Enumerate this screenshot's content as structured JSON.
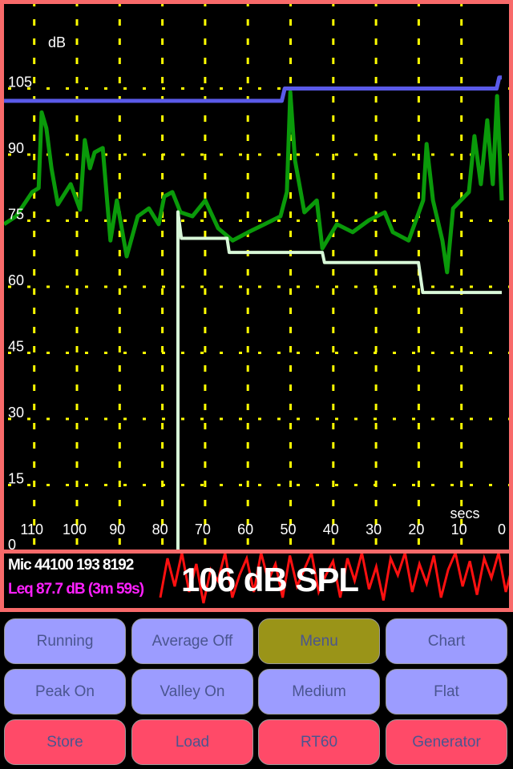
{
  "colors": {
    "frame": "#f86a6a",
    "level_line": "#0a9a0a",
    "peak_line": "#5a5ae8",
    "valley_line": "#d8f8d8",
    "grid": "#ffff00",
    "waveform": "#ff1010",
    "button_blue": "#9c9cff",
    "button_olive": "#9a9418",
    "button_red": "#ff4a68"
  },
  "chart_data": {
    "type": "line",
    "ylabel": "dB",
    "xlabel": "secs",
    "xlim": [
      117,
      0
    ],
    "ylim": [
      0,
      110
    ],
    "y_ticks": [
      "105",
      "90",
      "75",
      "60",
      "45",
      "30",
      "15",
      "0"
    ],
    "y_tick_values": [
      105,
      90,
      75,
      60,
      45,
      30,
      15,
      0
    ],
    "x_ticks": [
      "110",
      "100",
      "90",
      "80",
      "70",
      "60",
      "50",
      "40",
      "30",
      "20",
      "10",
      "0"
    ],
    "x_tick_values": [
      110,
      100,
      90,
      80,
      70,
      60,
      50,
      40,
      30,
      20,
      10,
      0
    ],
    "grid": true,
    "series": [
      {
        "key": "level",
        "points": [
          [
            116.5,
            74.2
          ],
          [
            113.7,
            76
          ],
          [
            109.9,
            81.5
          ],
          [
            108.4,
            82.4
          ],
          [
            107.7,
            99.6
          ],
          [
            106.6,
            96
          ],
          [
            105.4,
            86.9
          ],
          [
            103.9,
            78.7
          ],
          [
            100.9,
            83.3
          ],
          [
            98.7,
            77.5
          ],
          [
            97.6,
            93.3
          ],
          [
            96.4,
            86.9
          ],
          [
            95.3,
            90.5
          ],
          [
            93.4,
            91.5
          ],
          [
            91.6,
            70.5
          ],
          [
            90.1,
            79.6
          ],
          [
            87.8,
            66.9
          ],
          [
            85.2,
            76
          ],
          [
            82.6,
            77.8
          ],
          [
            80.3,
            74.2
          ],
          [
            79,
            80.5
          ],
          [
            77.1,
            81.5
          ],
          [
            75.2,
            76.9
          ],
          [
            72.4,
            76
          ],
          [
            69.4,
            79.6
          ],
          [
            66.4,
            73.3
          ],
          [
            63,
            70.5
          ],
          [
            59.3,
            72.4
          ],
          [
            55.5,
            74.2
          ],
          [
            51.8,
            76
          ],
          [
            50.3,
            81.5
          ],
          [
            49.5,
            104.2
          ],
          [
            48.4,
            88.7
          ],
          [
            46.2,
            76.9
          ],
          [
            43.3,
            79.6
          ],
          [
            42,
            68.7
          ],
          [
            38.6,
            74.2
          ],
          [
            34.9,
            72.4
          ],
          [
            31.1,
            75.1
          ],
          [
            27.4,
            76.9
          ],
          [
            25.5,
            72.4
          ],
          [
            21.8,
            70.5
          ],
          [
            18.4,
            79.6
          ],
          [
            17.6,
            92.4
          ],
          [
            16.1,
            79.6
          ],
          [
            13.9,
            70.5
          ],
          [
            12.8,
            63.3
          ],
          [
            11.4,
            77.8
          ],
          [
            7.7,
            81.5
          ],
          [
            6.4,
            94.2
          ],
          [
            4.9,
            83.3
          ],
          [
            3.4,
            97.8
          ],
          [
            2.1,
            83.3
          ],
          [
            1.1,
            103.3
          ],
          [
            0,
            79.6
          ]
        ]
      },
      {
        "key": "peak",
        "points": [
          [
            116.5,
            102.2
          ],
          [
            51.5,
            102.2
          ],
          [
            50.8,
            105
          ],
          [
            1.2,
            105
          ],
          [
            0.6,
            107.5
          ],
          [
            0,
            107.5
          ]
        ]
      },
      {
        "key": "valley",
        "points": [
          [
            75.8,
            0
          ],
          [
            75.8,
            77
          ],
          [
            75,
            71
          ],
          [
            64.3,
            71
          ],
          [
            63.8,
            67.8
          ],
          [
            42,
            67.8
          ],
          [
            41.5,
            65.5
          ],
          [
            19.5,
            65.5
          ],
          [
            18.5,
            58.7
          ],
          [
            0,
            58.7
          ]
        ]
      }
    ],
    "waveform": [
      0.2,
      0.9,
      0.4,
      1,
      0.3,
      0.8,
      0.1,
      0.7,
      0.5,
      1,
      0.2,
      0.6,
      0.9,
      0.3,
      1,
      0.5,
      0.8,
      0.2,
      0.95,
      0.4,
      0.7,
      1,
      0.3,
      0.6,
      0.85,
      0.2,
      0.9,
      0.5,
      1,
      0.35,
      0.75,
      0.15,
      0.9,
      0.6,
      1,
      0.3,
      0.8,
      0.45,
      0.95,
      0.2,
      0.7,
      1,
      0.4,
      0.85,
      0.25,
      0.9,
      0.55,
      1,
      0.3,
      0.8
    ]
  },
  "status": {
    "mic_info": "Mic 44100 193 8192",
    "leq": "Leq  87.7 dB (3m 59s)",
    "spl": "106 dB SPL"
  },
  "buttons": [
    {
      "label": "Running",
      "style": "blue"
    },
    {
      "label": "Average Off",
      "style": "blue"
    },
    {
      "label": "Menu",
      "style": "olive"
    },
    {
      "label": "Chart",
      "style": "blue"
    },
    {
      "label": "Peak On",
      "style": "blue"
    },
    {
      "label": "Valley On",
      "style": "blue"
    },
    {
      "label": "Medium",
      "style": "blue"
    },
    {
      "label": "Flat",
      "style": "blue"
    },
    {
      "label": "Store",
      "style": "red"
    },
    {
      "label": "Load",
      "style": "red"
    },
    {
      "label": "RT60",
      "style": "red"
    },
    {
      "label": "Generator",
      "style": "red"
    }
  ]
}
